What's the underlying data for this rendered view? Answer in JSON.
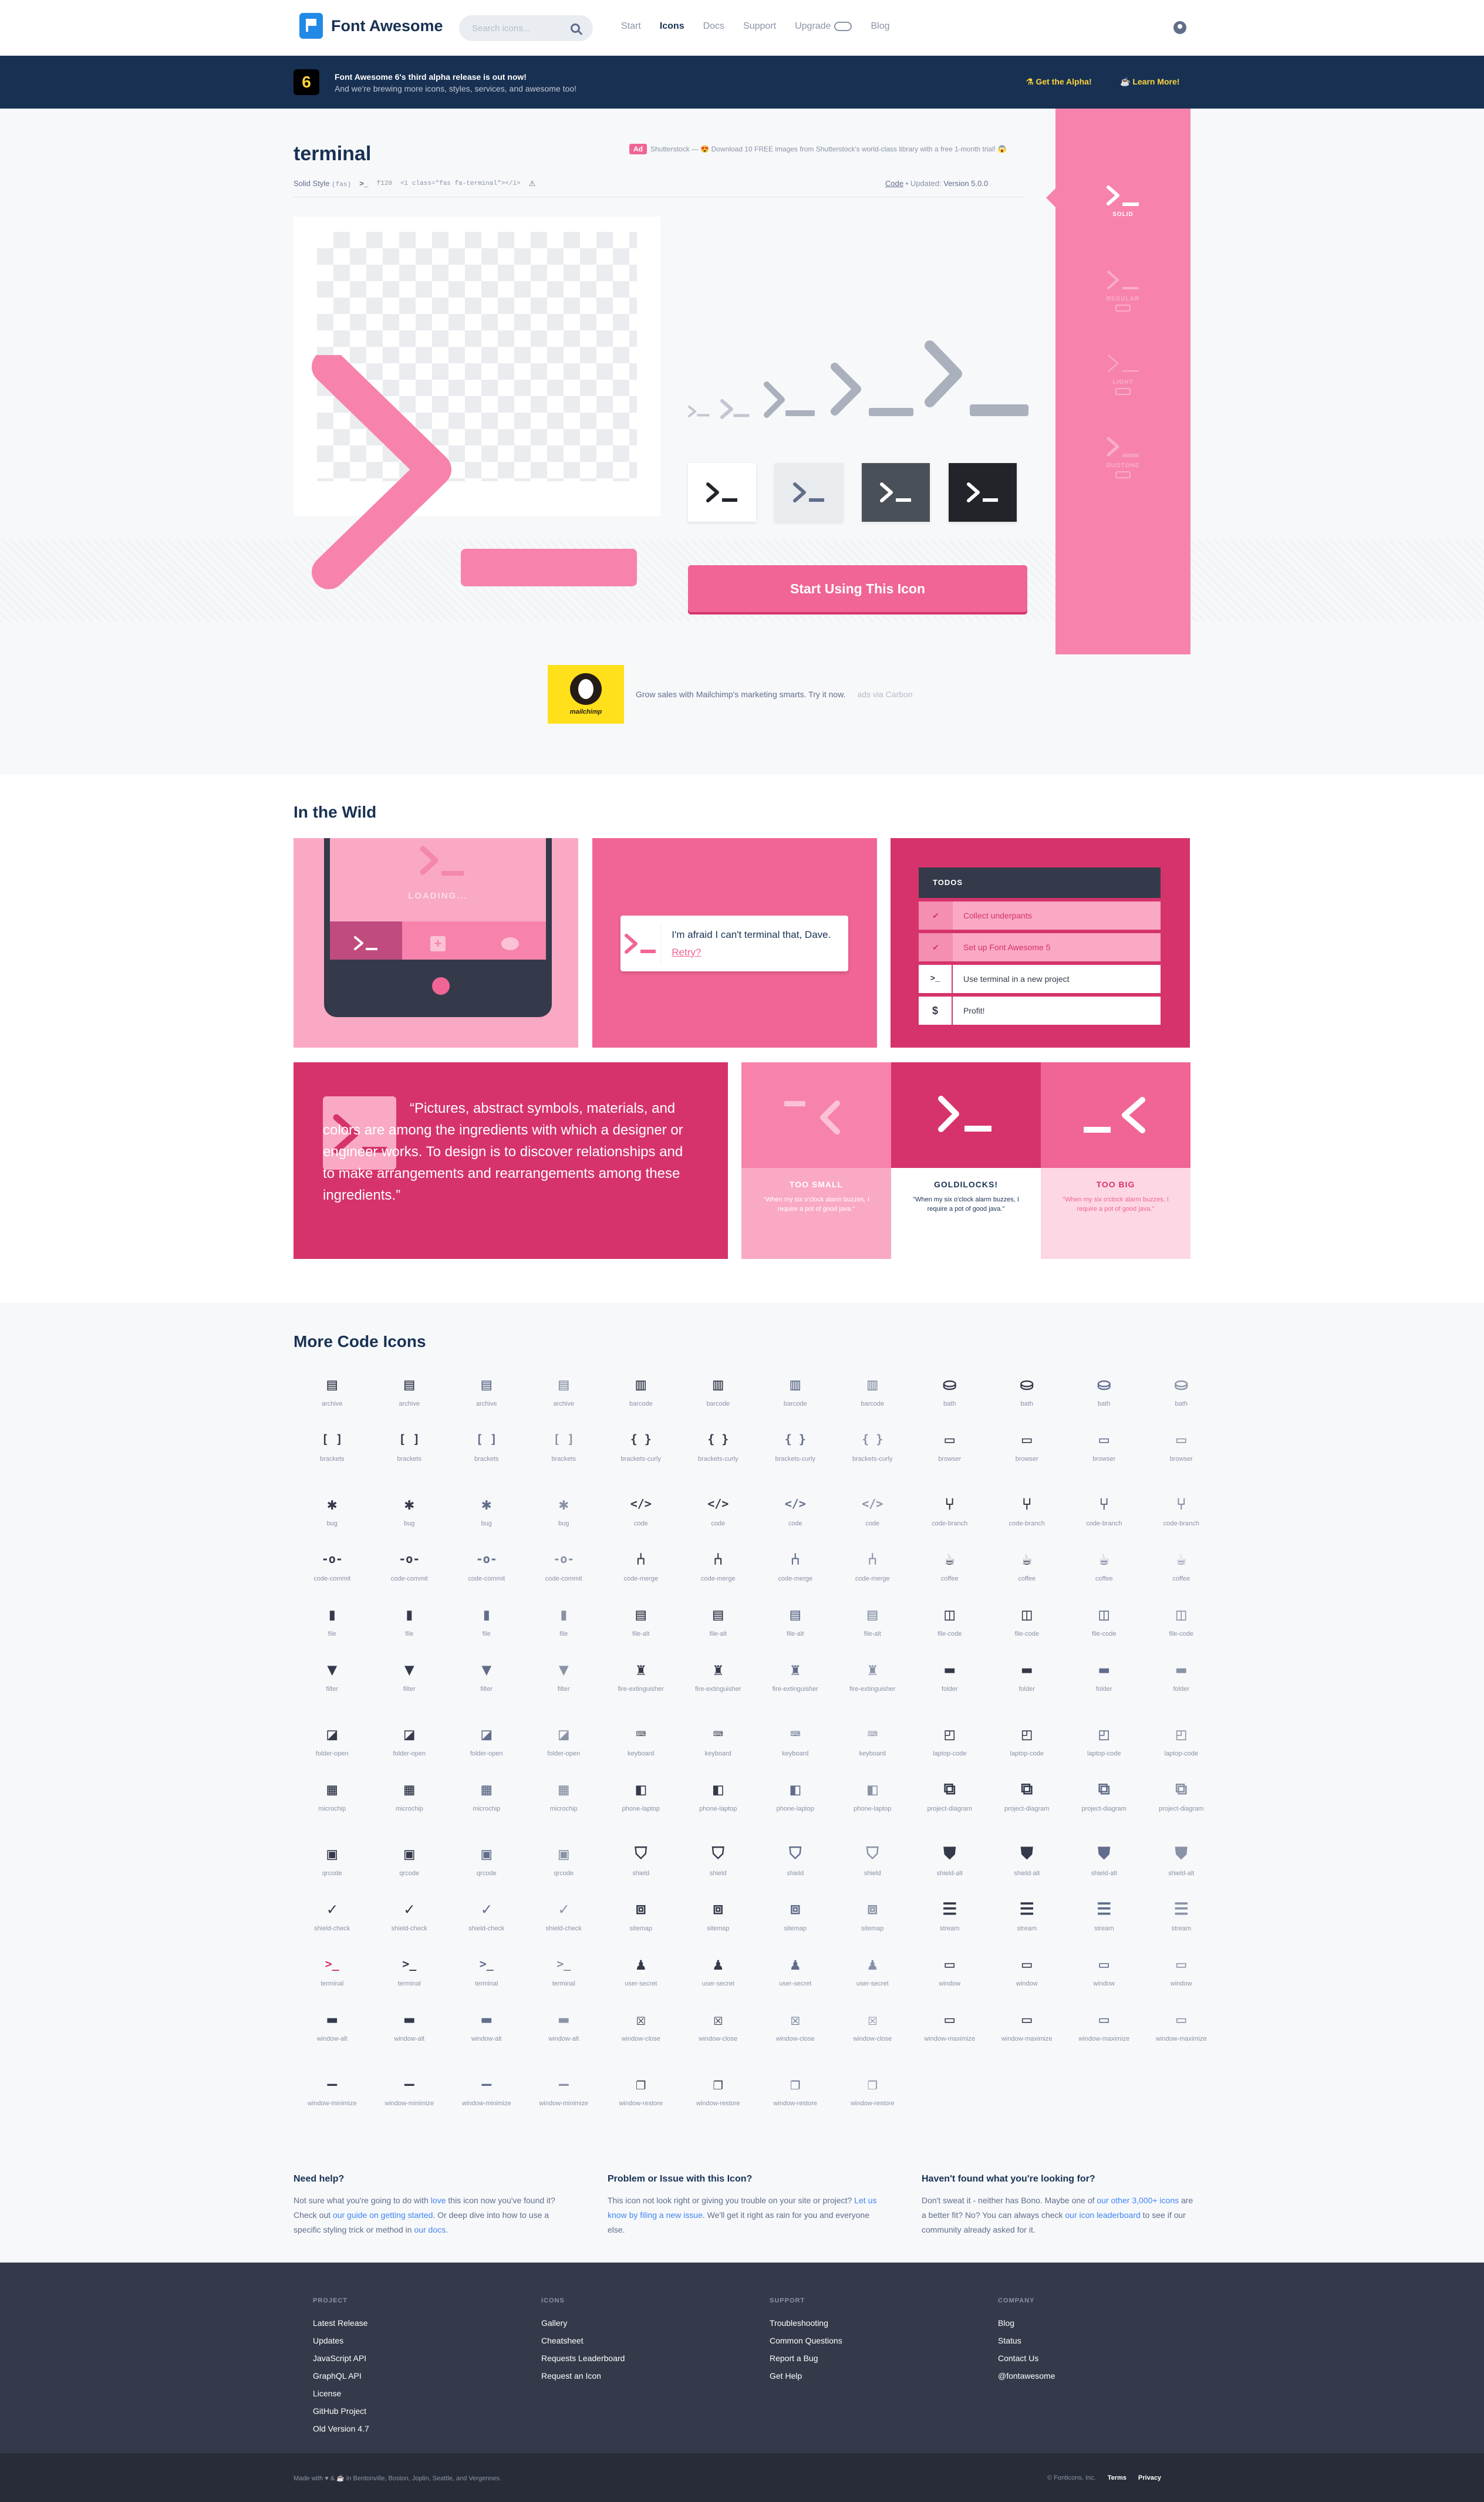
{
  "nav": {
    "brand": "Font Awesome",
    "search_placeholder": "Search icons...",
    "links": [
      "Start",
      "Icons",
      "Docs",
      "Support",
      "Upgrade",
      "Blog"
    ],
    "active": "Icons"
  },
  "banner": {
    "badge": "6",
    "headline": "Font Awesome 6's third alpha release is out now!",
    "subline": "And we're brewing more icons, styles, services, and awesome too!",
    "cta1": "Get the Alpha!",
    "cta2": "Learn More!"
  },
  "icon": {
    "name": "terminal",
    "style_label": "Solid Style",
    "style_code": "(fas)",
    "unicode": "f120",
    "html": "<i class=\"fas fa-terminal\"></i>",
    "code_link": "Code",
    "updated_label": "Updated:",
    "version": "Version 5.0.0",
    "start_button": "Start Using This Icon"
  },
  "top_ad": {
    "tag": "Ad",
    "text": "Shutterstock — 😍 Download 10 FREE images from Shutterstock's world-class library with a free 1-month trial! 😱"
  },
  "styles": [
    {
      "label": "SOLID",
      "active": true
    },
    {
      "label": "REGULAR",
      "active": false
    },
    {
      "label": "LIGHT",
      "active": false
    },
    {
      "label": "DUOTONE",
      "active": false
    }
  ],
  "carbon": {
    "brand": "mailchimp",
    "text": "Grow sales with Mailchimp's marketing smarts. Try it now.",
    "via": "ads via Carbon"
  },
  "wild": {
    "title": "In the Wild",
    "loading": "LOADING...",
    "alert_text": "I'm afraid I can't terminal that, Dave.",
    "alert_link": "Retry?",
    "todo_title": "TODOS",
    "todos": [
      "Collect underpants",
      "Set up Font Awesome 5",
      "Use terminal in a new project",
      "Profit!"
    ],
    "quote": "“Pictures, abstract symbols, materials, and colors are among the ingredients with which a designer or engineer works. To design is to discover relationships and to make arrangements and rearrangements among these ingredients.”",
    "sizes": [
      {
        "label": "TOO SMALL",
        "desc": "\"When my six o'clock alarm buzzes, I require a pot of good java.\""
      },
      {
        "label": "GOLDILOCKS!",
        "desc": "\"When my six o'clock alarm buzzes, I require a pot of good java.\""
      },
      {
        "label": "TOO BIG",
        "desc": "\"When my six o'clock alarm buzzes, I require a pot of good java.\""
      }
    ]
  },
  "more": {
    "title": "More Code Icons",
    "icons": [
      "archive",
      "archive",
      "archive",
      "archive",
      "barcode",
      "barcode",
      "barcode",
      "barcode",
      "bath",
      "bath",
      "bath",
      "bath",
      "brackets",
      "brackets",
      "brackets",
      "brackets",
      "brackets-curly",
      "brackets-curly",
      "brackets-curly",
      "brackets-curly",
      "browser",
      "browser",
      "browser",
      "browser",
      "bug",
      "bug",
      "bug",
      "bug",
      "code",
      "code",
      "code",
      "code",
      "code-branch",
      "code-branch",
      "code-branch",
      "code-branch",
      "code-commit",
      "code-commit",
      "code-commit",
      "code-commit",
      "code-merge",
      "code-merge",
      "code-merge",
      "code-merge",
      "coffee",
      "coffee",
      "coffee",
      "coffee",
      "file",
      "file",
      "file",
      "file",
      "file-alt",
      "file-alt",
      "file-alt",
      "file-alt",
      "file-code",
      "file-code",
      "file-code",
      "file-code",
      "filter",
      "filter",
      "filter",
      "filter",
      "fire-extinguisher",
      "fire-extinguisher",
      "fire-extinguisher",
      "fire-extinguisher",
      "folder",
      "folder",
      "folder",
      "folder",
      "folder-open",
      "folder-open",
      "folder-open",
      "folder-open",
      "keyboard",
      "keyboard",
      "keyboard",
      "keyboard",
      "laptop-code",
      "laptop-code",
      "laptop-code",
      "laptop-code",
      "microchip",
      "microchip",
      "microchip",
      "microchip",
      "phone-laptop",
      "phone-laptop",
      "phone-laptop",
      "phone-laptop",
      "project-diagram",
      "project-diagram",
      "project-diagram",
      "project-diagram",
      "qrcode",
      "qrcode",
      "qrcode",
      "qrcode",
      "shield",
      "shield",
      "shield",
      "shield",
      "shield-alt",
      "shield-alt",
      "shield-alt",
      "shield-alt",
      "shield-check",
      "shield-check",
      "shield-check",
      "shield-check",
      "sitemap",
      "sitemap",
      "sitemap",
      "sitemap",
      "stream",
      "stream",
      "stream",
      "stream",
      "terminal",
      "terminal",
      "terminal",
      "terminal",
      "user-secret",
      "user-secret",
      "user-secret",
      "user-secret",
      "window",
      "window",
      "window",
      "window",
      "window-alt",
      "window-alt",
      "window-alt",
      "window-alt",
      "window-close",
      "window-close",
      "window-close",
      "window-close",
      "window-maximize",
      "window-maximize",
      "window-maximize",
      "window-maximize",
      "window-minimize",
      "window-minimize",
      "window-minimize",
      "window-minimize",
      "window-restore",
      "window-restore",
      "window-restore",
      "window-restore"
    ]
  },
  "help": [
    {
      "title": "Need help?",
      "pre": "Not sure what you're going to do with ",
      "l1": "love",
      "mid": " this icon now you've found it? Check out ",
      "l2": "our guide on getting started",
      "mid2": ". Or deep dive into how to use a specific styling trick or method in ",
      "l3": "our docs",
      "post": "."
    },
    {
      "title": "Problem or Issue with this Icon?",
      "pre": "This icon not look right or giving you trouble on your site or project? ",
      "l1": "Let us know by filing a new issue",
      "mid": ". We'll get it right as rain for you and everyone else.",
      "l2": "",
      "mid2": "",
      "l3": "",
      "post": ""
    },
    {
      "title": "Haven't found what you're looking for?",
      "pre": "Don't sweat it - neither has Bono. Maybe one of ",
      "l1": "our other 3,000+ icons",
      "mid": " are a better fit? No? You can always check ",
      "l2": "our icon leaderboard",
      "mid2": " to see if our community already asked for it.",
      "l3": "",
      "post": ""
    }
  ],
  "footer": [
    {
      "title": "PROJECT",
      "items": [
        "Latest Release",
        "Updates",
        "JavaScript API",
        "GraphQL API",
        "License",
        "GitHub Project",
        "Old Version 4.7"
      ]
    },
    {
      "title": "ICONS",
      "items": [
        "Gallery",
        "Cheatsheet",
        "Requests Leaderboard",
        "Request an Icon"
      ]
    },
    {
      "title": "SUPPORT",
      "items": [
        "Troubleshooting",
        "Common Questions",
        "Report a Bug",
        "Get Help"
      ]
    },
    {
      "title": "COMPANY",
      "items": [
        "Blog",
        "Status",
        "Contact Us",
        "@fontawesome"
      ]
    }
  ],
  "subfooter": {
    "made_with": "Made with ♥ & ☕ in Bentonville, Boston, Joplin, Seattle, and Vergennes.",
    "company": "© Fonticons, Inc.",
    "terms": "Terms",
    "privacy": "Privacy"
  },
  "colors": {
    "brand_pink": "#f06595",
    "navy": "#183153",
    "pink_light": "#f783ac"
  }
}
